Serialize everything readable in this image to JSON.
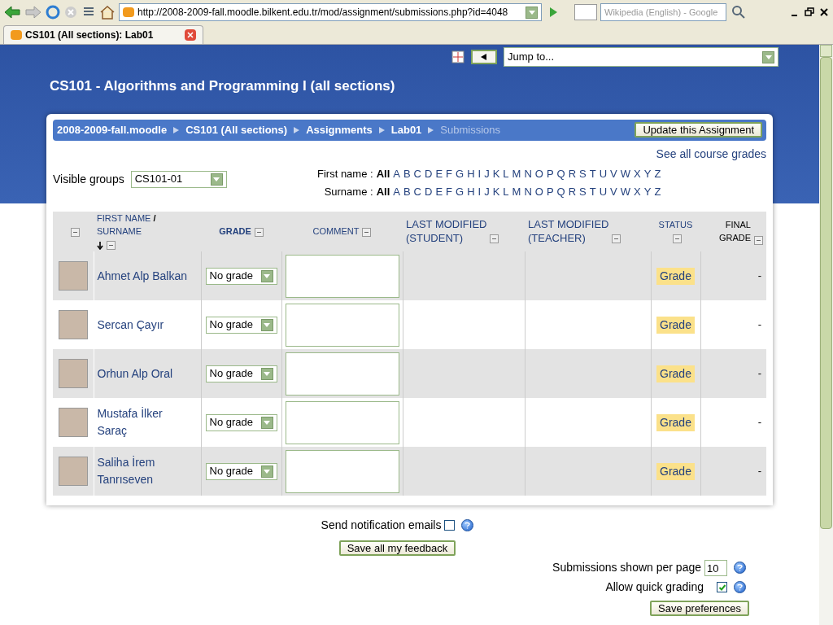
{
  "browser": {
    "url": "http://2008-2009-fall.moodle.bilkent.edu.tr/mod/assignment/submissions.php?id=4048",
    "search_placeholder": "Wikipedia (English) - Google",
    "tab_title": "CS101 (All sections): Lab01"
  },
  "jump_to": "Jump to...",
  "course_title": "CS101 - Algorithms and Programming I (all sections)",
  "breadcrumb": [
    {
      "label": "2008-2009-fall.moodle",
      "kind": "link"
    },
    {
      "label": "CS101 (All sections)",
      "kind": "link"
    },
    {
      "label": "Assignments",
      "kind": "link"
    },
    {
      "label": "Lab01",
      "kind": "link"
    },
    {
      "label": "Submissions",
      "kind": "current"
    }
  ],
  "update_button": "Update this Assignment",
  "see_grades": "See all course grades",
  "visible_groups": {
    "label": "Visible groups",
    "value": "CS101-01"
  },
  "filters": [
    {
      "label": "First name :",
      "letters": [
        {
          "text": "All",
          "selected": true
        },
        {
          "text": "A",
          "selected": false
        },
        {
          "text": "B",
          "selected": false
        },
        {
          "text": "C",
          "selected": false
        },
        {
          "text": "D",
          "selected": false
        },
        {
          "text": "E",
          "selected": false
        },
        {
          "text": "F",
          "selected": false
        },
        {
          "text": "G",
          "selected": false
        },
        {
          "text": "H",
          "selected": false
        },
        {
          "text": "I",
          "selected": false
        },
        {
          "text": "J",
          "selected": false
        },
        {
          "text": "K",
          "selected": false
        },
        {
          "text": "L",
          "selected": false
        },
        {
          "text": "M",
          "selected": false
        },
        {
          "text": "N",
          "selected": false
        },
        {
          "text": "O",
          "selected": false
        },
        {
          "text": "P",
          "selected": false
        },
        {
          "text": "Q",
          "selected": false
        },
        {
          "text": "R",
          "selected": false
        },
        {
          "text": "S",
          "selected": false
        },
        {
          "text": "T",
          "selected": false
        },
        {
          "text": "U",
          "selected": false
        },
        {
          "text": "V",
          "selected": false
        },
        {
          "text": "W",
          "selected": false
        },
        {
          "text": "X",
          "selected": false
        },
        {
          "text": "Y",
          "selected": false
        },
        {
          "text": "Z",
          "selected": false
        }
      ]
    },
    {
      "label": "Surname :",
      "letters": [
        {
          "text": "All",
          "selected": true
        },
        {
          "text": "A",
          "selected": false
        },
        {
          "text": "B",
          "selected": false
        },
        {
          "text": "C",
          "selected": false
        },
        {
          "text": "D",
          "selected": false
        },
        {
          "text": "E",
          "selected": false
        },
        {
          "text": "F",
          "selected": false
        },
        {
          "text": "G",
          "selected": false
        },
        {
          "text": "H",
          "selected": false
        },
        {
          "text": "I",
          "selected": false
        },
        {
          "text": "J",
          "selected": false
        },
        {
          "text": "K",
          "selected": false
        },
        {
          "text": "L",
          "selected": false
        },
        {
          "text": "M",
          "selected": false
        },
        {
          "text": "N",
          "selected": false
        },
        {
          "text": "O",
          "selected": false
        },
        {
          "text": "P",
          "selected": false
        },
        {
          "text": "Q",
          "selected": false
        },
        {
          "text": "R",
          "selected": false
        },
        {
          "text": "S",
          "selected": false
        },
        {
          "text": "T",
          "selected": false
        },
        {
          "text": "U",
          "selected": false
        },
        {
          "text": "V",
          "selected": false
        },
        {
          "text": "W",
          "selected": false
        },
        {
          "text": "X",
          "selected": false
        },
        {
          "text": "Y",
          "selected": false
        },
        {
          "text": "Z",
          "selected": false
        }
      ]
    }
  ],
  "columns": {
    "name_first": "FIRST NAME",
    "name_sep": "/",
    "name_last": "SURNAME",
    "grade": "GRADE",
    "comment": "COMMENT",
    "modified_student_1": "LAST MODIFIED",
    "modified_student_2": "(STUDENT)",
    "modified_teacher_1": "LAST MODIFIED",
    "modified_teacher_2": "(TEACHER)",
    "status": "STATUS",
    "final_1": "FINAL",
    "final_2": "GRADE"
  },
  "rows": [
    {
      "name": "Ahmet Alp Balkan",
      "grade": "No grade",
      "status": "Grade",
      "final": "-"
    },
    {
      "name": "Sercan Çayır",
      "grade": "No grade",
      "status": "Grade",
      "final": "-"
    },
    {
      "name": "Orhun Alp Oral",
      "grade": "No grade",
      "status": "Grade",
      "final": "-"
    },
    {
      "name": "Mustafa İlker Saraç",
      "grade": "No grade",
      "status": "Grade",
      "final": "-"
    },
    {
      "name": "Saliha İrem Tanrıseven",
      "grade": "No grade",
      "status": "Grade",
      "final": "-"
    }
  ],
  "notify": {
    "label": "Send notification emails",
    "checked": false
  },
  "save_feedback": "Save all my feedback",
  "per_page": {
    "label": "Submissions shown per page",
    "value": "10"
  },
  "quick_grading": {
    "label": "Allow quick grading",
    "checked": true
  },
  "save_preferences": "Save preferences"
}
